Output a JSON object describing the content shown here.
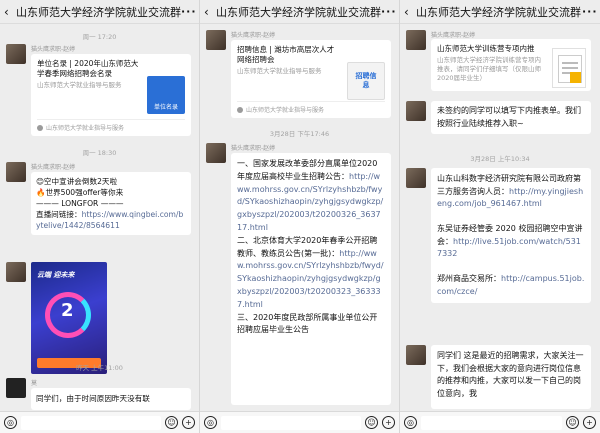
{
  "panels": [
    {
      "title": "山东师范大学经济学院就业交流群(133)",
      "messages": [
        {
          "time": "周一 17:20"
        },
        {
          "nick": "猫头鹰求职-赵婷",
          "card": {
            "title": "单位名录 | 2020年山东师范大学春季网络招聘会名录",
            "desc": "山东师范大学就业指导与服务",
            "thumb_label": "单位名录",
            "source": "山东师范大学就业指导与服务"
          }
        },
        {
          "time": "周一 18:30"
        },
        {
          "nick": "猫头鹰求职-赵婷",
          "text": "😊空中宣讲会倒数2天啦\n🔥世界500强offer等你来\n——— LONGFOR ———\n直播间链接：https://www.qingbei.com/bytelive/1442/8564611"
        },
        {
          "poster_text": "云端 迎未来"
        },
        {
          "time": "昨天 上午11:00"
        },
        {
          "nick": "莫",
          "text": "同学们，由于时间原因昨天没有联"
        }
      ]
    },
    {
      "title": "山东师范大学经济学院就业交流群(133)",
      "messages": [
        {
          "nick": "猫头鹰求职-赵婷",
          "card": {
            "title": "招聘信息 | 潍坊市高层次人才网络招聘会",
            "desc": "山东师范大学就业指导与服务",
            "thumb_label": "招聘信息",
            "source": "山东师范大学就业指导与服务"
          }
        },
        {
          "time": "3月28日 下午17:46"
        },
        {
          "nick": "猫头鹰求职-赵婷",
          "text": "一、国家发展改革委部分直属单位2020年度应届高校毕业生招聘公告：http://www.mohrss.gov.cn/SYrlzyhshbzb/fwyd/SYkaoshizhaopin/zyhgjgsydwgkzp/gxbyszpzl/202003/t20200326_363717.html\n二、北京体育大学2020年春季公开招聘教师、教练员公告(第一批)：http://www.mohrss.gov.cn/SYrlzyhshbzb/fwyd/SYkaoshizhaopin/zyhgjgsydwgkzp/gxbyszpzl/202003/t20200323_363337.html\n三、2020年度民政部所属事业单位公开招聘应届毕业生公告"
        }
      ]
    },
    {
      "title": "山东师范大学经济学院就业交流群(133)",
      "messages": [
        {
          "nick": "猫头鹰求职-赵婷",
          "card": {
            "title": "山东师范大学训练营专项内推",
            "desc": "山东师范大学经济学院训练营专项内推表，请同学们仔细填写（仅限山师2020届毕业生）"
          }
        },
        {
          "text": "未签约的同学可以填写下内推表单。我们按照行业陆续推荐入职~"
        },
        {
          "time": "3月28日 上午10:34"
        },
        {
          "text": "山东山科数字经济研究院有限公司政府第三方服务咨询人员：http://my.yingjiesheng.com/job_961467.html\n\n东吴证券经管委 2020 校园招聘空中宣讲会：http://live.51job.com/watch/5317332\n\n郑州商品交易所：http://campus.51job.com/czce/"
        },
        {
          "text": "同学们 这是最近的招聘需求，大家关注一下，我们会根据大家的意向进行岗位信息的推荐和内推，大家可以发一下自己的岗位意向，我"
        }
      ]
    }
  ],
  "colors": {
    "link": "#576b95",
    "bg": "#ededed",
    "bubble": "#ffffff"
  },
  "icons": {
    "back": "chevron-left-icon",
    "more": "more-icon",
    "voice": "voice-icon",
    "emoji": "emoji-icon",
    "plus": "plus-icon"
  }
}
